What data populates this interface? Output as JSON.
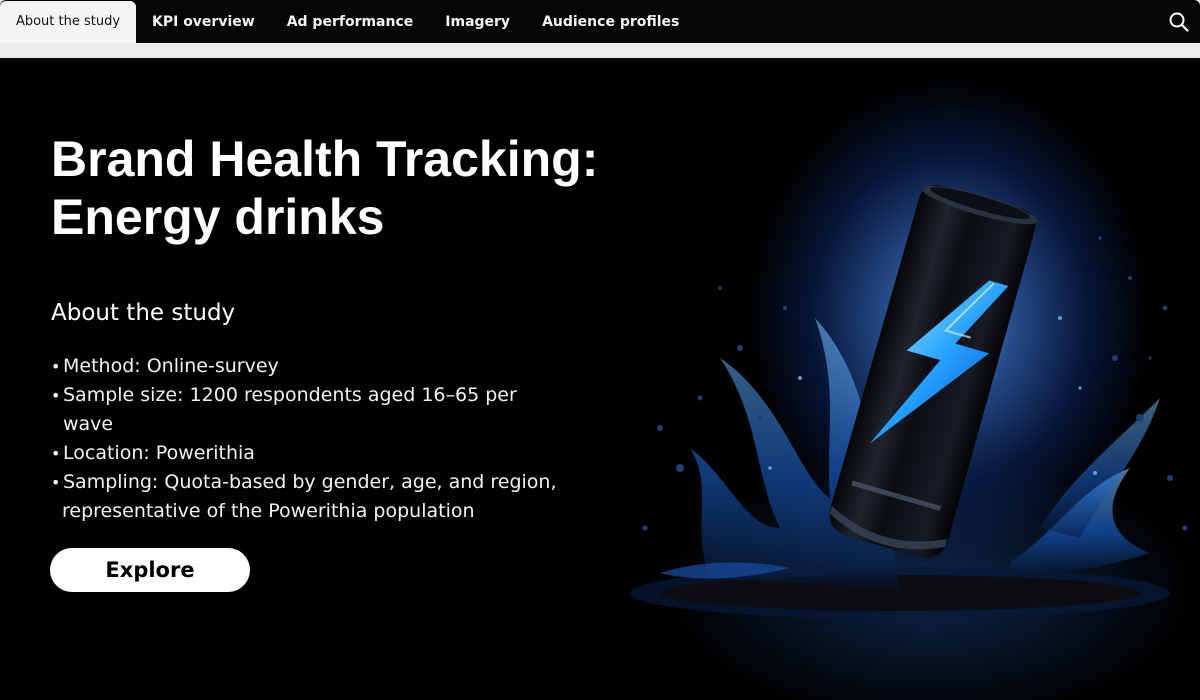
{
  "nav": {
    "tabs": [
      {
        "label": "About the study",
        "active": true
      },
      {
        "label": "KPI overview",
        "active": false
      },
      {
        "label": "Ad performance",
        "active": false
      },
      {
        "label": "Imagery",
        "active": false
      },
      {
        "label": "Audience profiles",
        "active": false
      }
    ],
    "search_icon": "search-icon"
  },
  "hero": {
    "title_line1": "Brand Health Tracking:",
    "title_line2": "Energy drinks",
    "section_heading": "About the study",
    "facts": [
      "Method: Online-survey",
      "Sample size: 1200 respondents aged 16–65 per wave",
      "Location: Powerithia",
      "Sampling: Quota-based by gender, age, and region,",
      "representative of the Powerithia population"
    ],
    "cta_label": "Explore",
    "image_subject": "energy-drink-can-splash"
  },
  "colors": {
    "nav_bg": "#050505",
    "active_tab_bg": "#f4f4f4",
    "hero_bg": "#000000",
    "accent_blue": "#2a8cff",
    "cta_bg": "#ffffff"
  }
}
